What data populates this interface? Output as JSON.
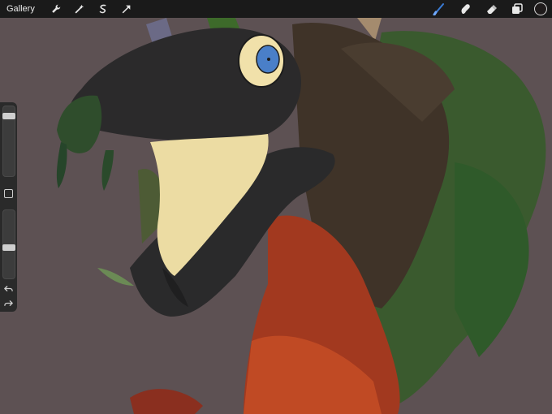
{
  "toolbar": {
    "gallery_label": "Gallery",
    "left_tools": [
      "wrench-icon",
      "magic-wand-icon",
      "selection-icon",
      "transform-arrow-icon"
    ],
    "right_tools": [
      "brush-icon",
      "smudge-icon",
      "eraser-icon",
      "layers-icon"
    ],
    "active_tool": "brush-icon",
    "active_color": "#1f1b1b",
    "accent_color": "#3a7bd5"
  },
  "sidebar": {
    "brush_size": 0.1,
    "brush_opacity": 0.54,
    "buttons": [
      "modify-square-icon",
      "undo-icon",
      "redo-icon"
    ]
  },
  "canvas": {
    "background_color": "#5d5153"
  }
}
